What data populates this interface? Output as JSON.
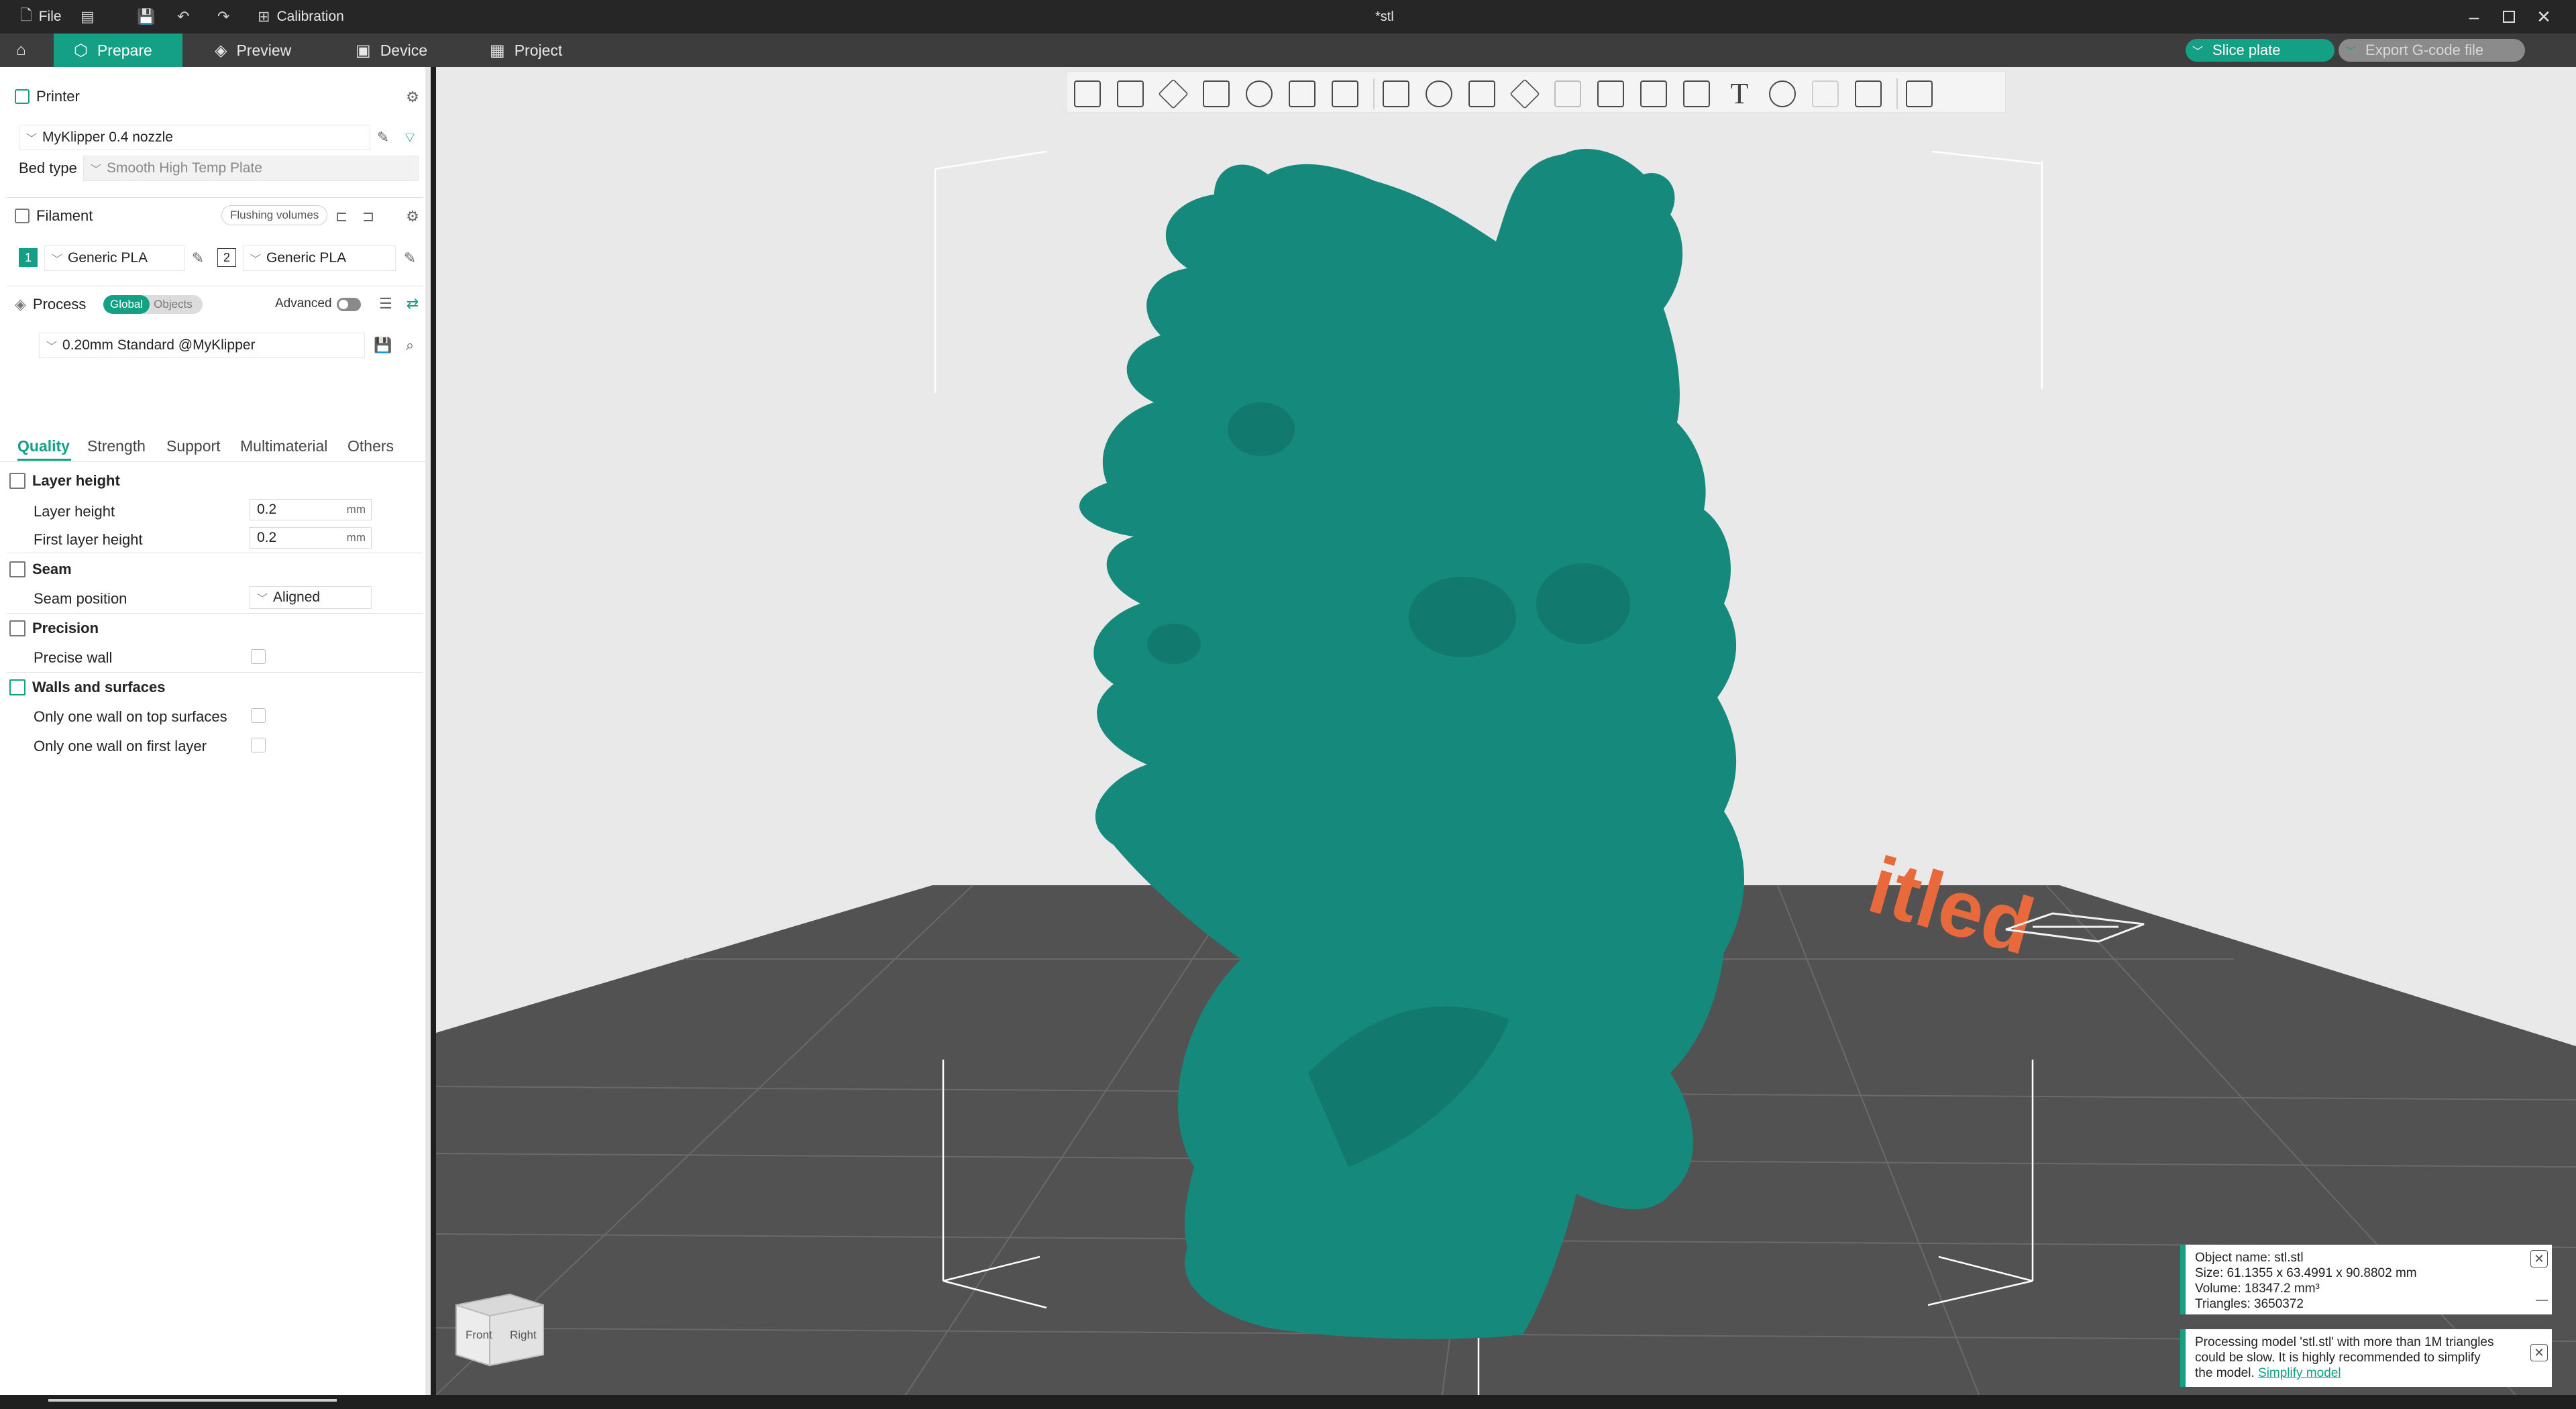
{
  "titlebar": {
    "file_label": "File",
    "calibration_label": "Calibration",
    "document_title": "*stl"
  },
  "tabs": {
    "prepare": "Prepare",
    "preview": "Preview",
    "device": "Device",
    "project": "Project"
  },
  "actions": {
    "slice_plate": "Slice plate",
    "export_gcode": "Export G-code file"
  },
  "printer": {
    "section_label": "Printer",
    "preset": "MyKlipper 0.4 nozzle",
    "bed_type_label": "Bed type",
    "bed_type_value": "Smooth High Temp Plate"
  },
  "filament": {
    "section_label": "Filament",
    "flushing_button": "Flushing volumes",
    "slots": [
      {
        "index": "1",
        "name": "Generic PLA"
      },
      {
        "index": "2",
        "name": "Generic PLA"
      }
    ]
  },
  "process": {
    "section_label": "Process",
    "scope_global": "Global",
    "scope_objects": "Objects",
    "advanced_label": "Advanced",
    "preset": "0.20mm Standard @MyKlipper",
    "subtabs": [
      "Quality",
      "Strength",
      "Support",
      "Multimaterial",
      "Others"
    ]
  },
  "quality": {
    "layer_height_group": "Layer height",
    "layer_height_label": "Layer height",
    "layer_height_value": "0.2",
    "first_layer_height_label": "First layer height",
    "first_layer_height_value": "0.2",
    "unit": "mm",
    "seam_group": "Seam",
    "seam_position_label": "Seam position",
    "seam_position_value": "Aligned",
    "precision_group": "Precision",
    "precise_wall_label": "Precise wall",
    "walls_group": "Walls and surfaces",
    "one_wall_top_label": "Only one wall on top surfaces",
    "one_wall_first_label": "Only one wall on first layer"
  },
  "viewport": {
    "plate_label": "itled",
    "view_cube_front": "Front",
    "view_cube_right": "Right"
  },
  "object_info": {
    "name_line": "Object name: stl.stl",
    "size_line": "Size: 61.1355 x 63.4991 x 90.8802 mm",
    "volume_line": "Volume: 18347.2 mm³",
    "triangles_line": "Triangles: 3650372"
  },
  "notification": {
    "message_line1": "Processing model 'stl.stl' with more than 1M triangles",
    "message_line2": "could be slow. It is highly recommended to simplify",
    "message_line3_prefix": "the model.",
    "link_text": "Simplify model"
  },
  "colors": {
    "accent": "#14a085",
    "model": "#15897c",
    "plate": "#525252",
    "plate_label": "#e8693c"
  }
}
